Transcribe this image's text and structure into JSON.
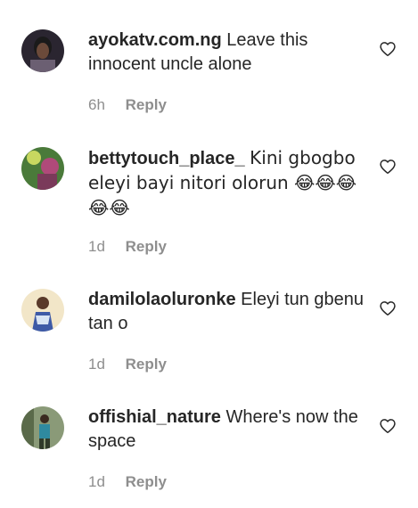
{
  "comments": [
    {
      "username": "ayokatv.com.ng",
      "text": "Leave this innocent uncle alone",
      "time": "6h",
      "reply_label": "Reply",
      "avatar_colors": [
        "#1a1a1a",
        "#6b5f72"
      ],
      "like_icon": "heart-outline-icon"
    },
    {
      "username": "bettytouch_place_",
      "text": "Kini gbogbo eleyi bayi nitori olorun 😂😂😂😂😂",
      "time": "1d",
      "reply_label": "Reply",
      "avatar_colors": [
        "#4a7a3a",
        "#b04a7a"
      ],
      "like_icon": "heart-outline-icon"
    },
    {
      "username": "damilolaoluronke",
      "text": "Eleyi tun gbenu tan o",
      "time": "1d",
      "reply_label": "Reply",
      "avatar_colors": [
        "#f2e6c8",
        "#3e5aa6"
      ],
      "like_icon": "heart-outline-icon"
    },
    {
      "username": "offishial_nature",
      "text": "Where's now the space",
      "time": "1d",
      "reply_label": "Reply",
      "avatar_colors": [
        "#8a9a78",
        "#2f3a2a"
      ],
      "like_icon": "heart-outline-icon"
    }
  ]
}
